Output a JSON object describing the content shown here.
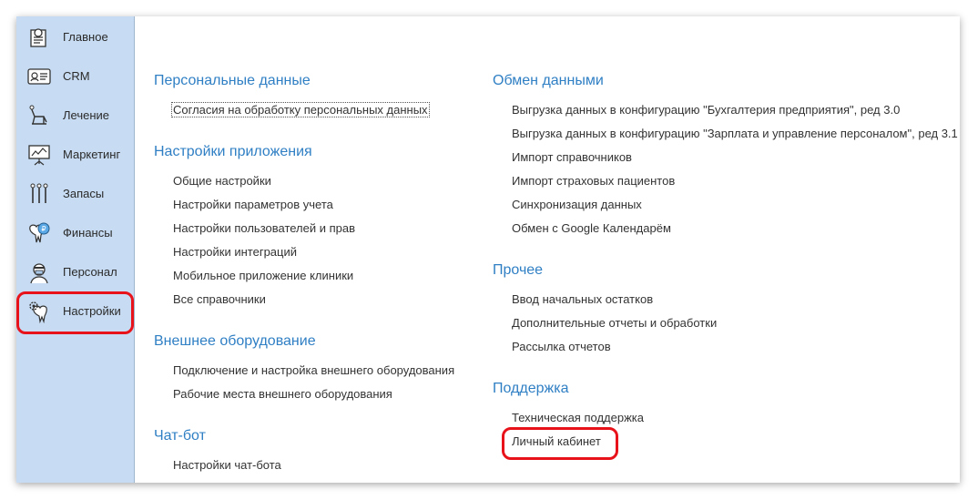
{
  "sidebar": {
    "items": [
      {
        "label": "Главное",
        "icon": "home-icon"
      },
      {
        "label": "CRM",
        "icon": "id-card-icon"
      },
      {
        "label": "Лечение",
        "icon": "dental-chair-icon"
      },
      {
        "label": "Маркетинг",
        "icon": "presentation-board-icon"
      },
      {
        "label": "Запасы",
        "icon": "dental-tools-icon"
      },
      {
        "label": "Финансы",
        "icon": "tooth-coin-icon"
      },
      {
        "label": "Персонал",
        "icon": "doctor-icon"
      },
      {
        "label": "Настройки",
        "icon": "tooth-gear-icon"
      }
    ]
  },
  "sections": {
    "personal": {
      "title": "Персональные данные",
      "links": [
        "Согласия на обработку персональных данных"
      ]
    },
    "app_settings": {
      "title": "Настройки приложения",
      "links": [
        "Общие настройки",
        "Настройки параметров учета",
        "Настройки пользователей и прав",
        "Настройки интеграций",
        "Мобильное приложение клиники",
        "Все справочники"
      ]
    },
    "hardware": {
      "title": "Внешнее оборудование",
      "links": [
        "Подключение и настройка внешнего оборудования",
        "Рабочие места внешнего оборудования"
      ]
    },
    "chatbot": {
      "title": "Чат-бот",
      "links": [
        "Настройки чат-бота"
      ]
    },
    "exchange": {
      "title": "Обмен данными",
      "links": [
        "Выгрузка данных в конфигурацию \"Бухгалтерия предприятия\", ред 3.0",
        "Выгрузка данных в конфигурацию \"Зарплата и управление персоналом\", ред 3.1",
        "Импорт справочников",
        "Импорт страховых пациентов",
        "Синхронизация данных",
        "Обмен с Google Календарём"
      ]
    },
    "other": {
      "title": "Прочее",
      "links": [
        "Ввод начальных остатков",
        "Дополнительные отчеты и обработки",
        "Рассылка отчетов"
      ]
    },
    "support": {
      "title": "Поддержка",
      "links": [
        "Техническая поддержка",
        "Личный кабинет"
      ]
    }
  },
  "colors": {
    "accent": "#2f7fc4",
    "sidebar_bg": "#c7dcf2",
    "highlight": "#e8121a"
  }
}
